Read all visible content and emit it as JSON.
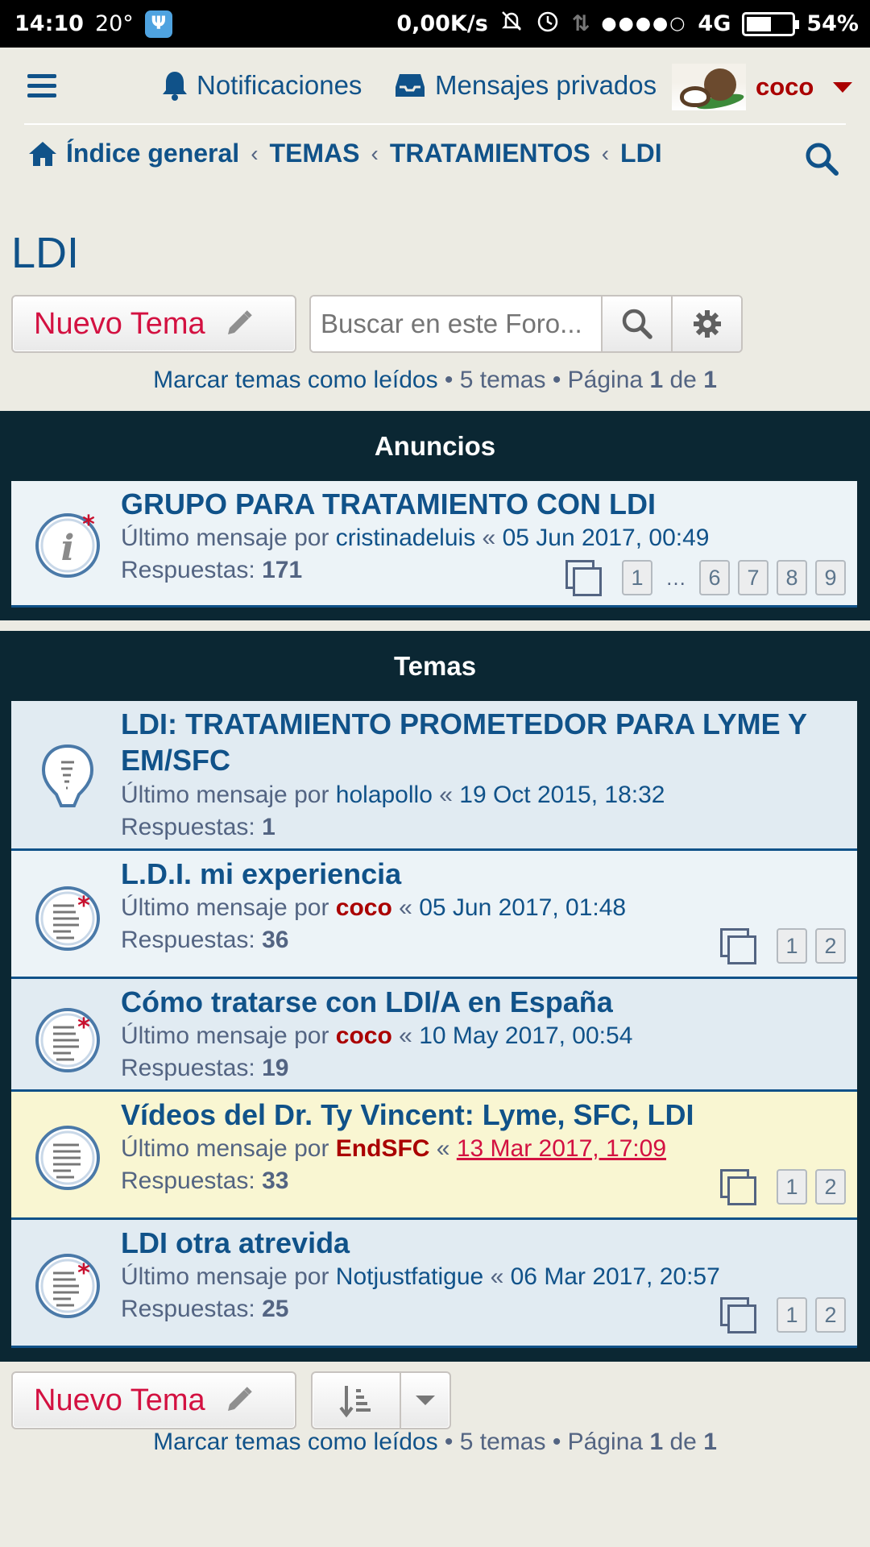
{
  "status_bar": {
    "time": "14:10",
    "temp": "20°",
    "speed": "0,00K/s",
    "network": "4G",
    "battery": "54%",
    "battery_level": 0.54
  },
  "header": {
    "notifications": "Notificaciones",
    "messages": "Mensajes privados",
    "username": "coco"
  },
  "breadcrumbs": [
    "Índice general",
    "TEMAS",
    "TRATAMIENTOS",
    "LDI"
  ],
  "forum_title": "LDI",
  "actions": {
    "new_topic": "Nuevo Tema",
    "search_placeholder": "Buscar en este Foro...",
    "mark_read": "Marcar temas como leídos",
    "topic_count": "5 temas",
    "page_word": "Página",
    "page_current": "1",
    "page_of": "de",
    "page_total": "1"
  },
  "announcements": {
    "heading": "Anuncios",
    "items": [
      {
        "title": "GRUPO PARA TRATAMIENTO CON LDI",
        "last_by": "Último mensaje por",
        "author": "cristinadeluis",
        "date": "05 Jun 2017, 00:49",
        "replies_label": "Respuestas:",
        "replies": "171",
        "pages": [
          "1",
          "…",
          "6",
          "7",
          "8",
          "9"
        ]
      }
    ]
  },
  "topics": {
    "heading": "Temas",
    "items": [
      {
        "title": "LDI: TRATAMIENTO PROMETEDOR PARA LYME Y EM/SFC",
        "last_by": "Último mensaje por",
        "author": "holapollo",
        "date": "19 Oct 2015, 18:32",
        "replies_label": "Respuestas:",
        "replies": "1"
      },
      {
        "title": "L.D.I. mi experiencia",
        "last_by": "Último mensaje por",
        "author": "coco",
        "date": "05 Jun 2017, 01:48",
        "replies_label": "Respuestas:",
        "replies": "36",
        "pages": [
          "1",
          "2"
        ]
      },
      {
        "title": "Cómo tratarse con LDI/A en España",
        "last_by": "Último mensaje por",
        "author": "coco",
        "date": "10 May 2017, 00:54",
        "replies_label": "Respuestas:",
        "replies": "19"
      },
      {
        "title": "Vídeos del Dr. Ty Vincent: Lyme, SFC, LDI",
        "last_by": "Último mensaje por",
        "author": "EndSFC",
        "date": "13 Mar 2017, 17:09",
        "replies_label": "Respuestas:",
        "replies": "33",
        "pages": [
          "1",
          "2"
        ]
      },
      {
        "title": "LDI otra atrevida",
        "last_by": "Último mensaje por",
        "author": "Notjustfatigue",
        "date": "06 Mar 2017, 20:57",
        "replies_label": "Respuestas:",
        "replies": "25",
        "pages": [
          "1",
          "2"
        ]
      }
    ]
  },
  "colors": {
    "link": "#105289",
    "section_header": "#0B2733",
    "accent_red": "#D31141",
    "user_red": "#AA0000",
    "sticky_bg": "#F9F6D2"
  }
}
